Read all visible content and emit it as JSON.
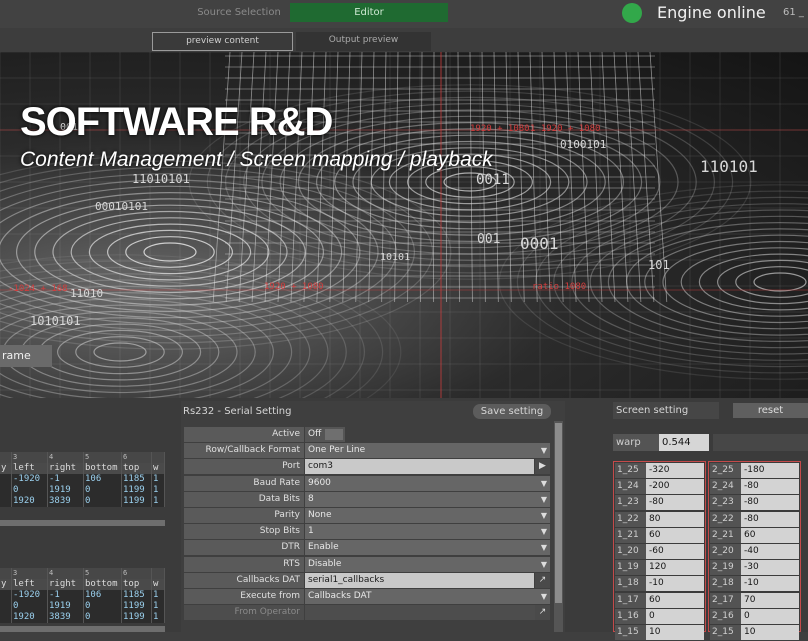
{
  "topbar": {
    "source_selection": "Source Selection",
    "editor": "Editor",
    "engine_status": "Engine online",
    "fps": "61 _"
  },
  "tabs": [
    {
      "label": "preview content",
      "active": true
    },
    {
      "label": "Output preview",
      "active": false
    }
  ],
  "hero": {
    "title": "SOFTWARE R&D",
    "subtitle": "Content Management / Screen mapping / playback",
    "frame_button": "rame",
    "binary": [
      "11010101",
      "00010101",
      "0011",
      "001",
      "0001",
      "101",
      "001",
      "11010",
      "110101",
      "1010101",
      "0100101",
      "10101"
    ],
    "red_tags": [
      "-1024 + 168",
      "1920 + 1080",
      "ratio 1080",
      "1 1920 + 1080",
      "1920 + 1080"
    ]
  },
  "tables": [
    {
      "col_numbers": [
        "",
        "3",
        "4",
        "5",
        "6",
        ""
      ],
      "headers": [
        "y",
        "left",
        "right",
        "bottom",
        "top",
        "w"
      ],
      "rows": [
        [
          "",
          "-1920",
          "-1",
          "106",
          "1185",
          "1"
        ],
        [
          "",
          "0",
          "1919",
          "0",
          "1199",
          "1"
        ],
        [
          "",
          "1920",
          "3839",
          "0",
          "1199",
          "1"
        ]
      ]
    },
    {
      "col_numbers": [
        "",
        "3",
        "4",
        "5",
        "6",
        ""
      ],
      "headers": [
        "y",
        "left",
        "right",
        "bottom",
        "top",
        "w"
      ],
      "rows": [
        [
          "",
          "-1920",
          "-1",
          "106",
          "1185",
          "1"
        ],
        [
          "",
          "0",
          "1919",
          "0",
          "1199",
          "1"
        ],
        [
          "",
          "1920",
          "3839",
          "0",
          "1199",
          "1"
        ]
      ]
    }
  ],
  "serial": {
    "title": "Rs232 - Serial Setting",
    "save_label": "Save setting",
    "params": [
      {
        "label": "Active",
        "value": "Off",
        "kind": "toggle"
      },
      {
        "label": "Row/Callback Format",
        "value": "One Per Line",
        "kind": "menu"
      },
      {
        "label": "Port",
        "value": "com3",
        "kind": "text",
        "side": "▶"
      },
      {
        "label": "Baud Rate",
        "value": "9600",
        "kind": "menu"
      },
      {
        "label": "Data Bits",
        "value": "8",
        "kind": "menu"
      },
      {
        "label": "Parity",
        "value": "None",
        "kind": "menu"
      },
      {
        "label": "Stop Bits",
        "value": "1",
        "kind": "menu"
      },
      {
        "label": "DTR",
        "value": "Enable",
        "kind": "menu"
      },
      {
        "label": "RTS",
        "value": "Disable",
        "kind": "menu"
      },
      {
        "label": "Callbacks DAT",
        "value": "serial1_callbacks",
        "kind": "text",
        "side": "↗"
      },
      {
        "label": "Execute from",
        "value": "Callbacks DAT",
        "kind": "menu"
      },
      {
        "label": "From Operator",
        "value": "",
        "kind": "dim",
        "side": "↗"
      }
    ]
  },
  "screen": {
    "title": "Screen setting",
    "reset_label": "reset",
    "warp_label": "warp",
    "warp_value": "0.544",
    "col1": [
      {
        "k": "1_25",
        "v": "-320"
      },
      {
        "k": "1_24",
        "v": "-200"
      },
      {
        "k": "1_23",
        "v": "-80"
      },
      {
        "k": "1_22",
        "v": "80"
      },
      {
        "k": "1_21",
        "v": "60"
      },
      {
        "k": "1_20",
        "v": "-60"
      },
      {
        "k": "1_19",
        "v": "120"
      },
      {
        "k": "1_18",
        "v": "-10"
      },
      {
        "k": "1_17",
        "v": "60"
      },
      {
        "k": "1_16",
        "v": "0"
      },
      {
        "k": "1_15",
        "v": "10"
      }
    ],
    "col2": [
      {
        "k": "2_25",
        "v": "-180"
      },
      {
        "k": "2_24",
        "v": "-80"
      },
      {
        "k": "2_23",
        "v": "-80"
      },
      {
        "k": "2_22",
        "v": "-80"
      },
      {
        "k": "2_21",
        "v": "60"
      },
      {
        "k": "2_20",
        "v": "-40"
      },
      {
        "k": "2_19",
        "v": "-30"
      },
      {
        "k": "2_18",
        "v": "-10"
      },
      {
        "k": "2_17",
        "v": "70"
      },
      {
        "k": "2_16",
        "v": "0"
      },
      {
        "k": "2_15",
        "v": "10"
      }
    ]
  }
}
